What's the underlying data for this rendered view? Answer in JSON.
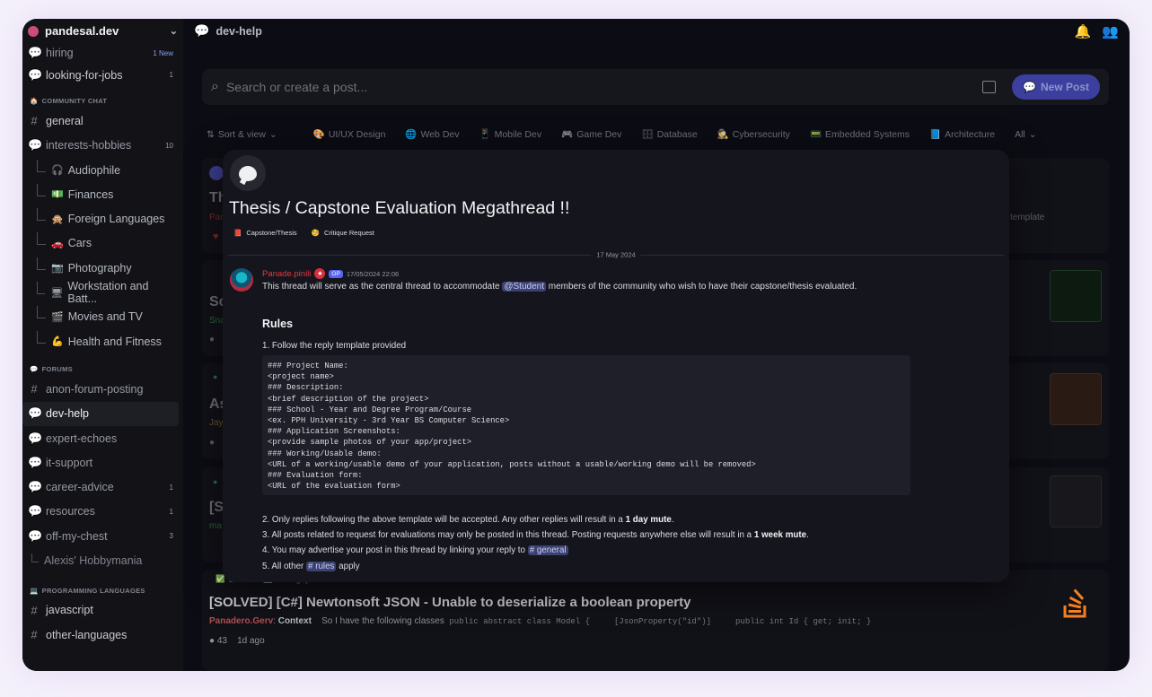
{
  "server": {
    "name": "pandesal.dev"
  },
  "sidebar": {
    "top_channels": [
      {
        "name": "hiring",
        "badge": "1 New"
      },
      {
        "name": "looking-for-jobs",
        "count": "1"
      }
    ],
    "community_chat": {
      "label": "COMMUNITY CHAT",
      "channels": [
        {
          "name": "general"
        },
        {
          "name": "interests-hobbies",
          "count": "10"
        }
      ]
    },
    "hobby_threads": [
      {
        "emoji": "🎧",
        "name": "Audiophile"
      },
      {
        "emoji": "💵",
        "name": "Finances"
      },
      {
        "emoji": "🙊",
        "name": "Foreign Languages"
      },
      {
        "emoji": "🚗",
        "name": "Cars"
      },
      {
        "emoji": "📷",
        "name": "Photography"
      },
      {
        "emoji": "🖥",
        "name": "Workstation and Batt..."
      },
      {
        "emoji": "🎬",
        "name": "Movies and TV"
      },
      {
        "emoji": "💪",
        "name": "Health and Fitness"
      }
    ],
    "forums": {
      "label": "FORUMS",
      "channels": [
        {
          "name": "anon-forum-posting",
          "count": ""
        },
        {
          "name": "dev-help",
          "count": ""
        },
        {
          "name": "expert-echoes",
          "count": ""
        },
        {
          "name": "it-support",
          "count": ""
        },
        {
          "name": "career-advice",
          "count": "1"
        },
        {
          "name": "resources",
          "count": "1"
        },
        {
          "name": "off-my-chest",
          "count": "3"
        }
      ]
    },
    "hobbymania": "Alexis' Hobbymania",
    "programming": {
      "label": "PROGRAMMING LANGUAGES",
      "channels": [
        {
          "name": "javascript"
        },
        {
          "name": "other-languages"
        }
      ]
    }
  },
  "header": {
    "channel": "dev-help"
  },
  "search": {
    "placeholder": "Search or create a post...",
    "new_post": "New Post"
  },
  "filters": {
    "sort": "Sort & view",
    "tags": [
      {
        "emoji": "🎨",
        "label": "UI/UX Design"
      },
      {
        "emoji": "🌐",
        "label": "Web Dev"
      },
      {
        "emoji": "📱",
        "label": "Mobile Dev"
      },
      {
        "emoji": "🎮",
        "label": "Game Dev"
      },
      {
        "emoji": "🗄",
        "label": "Database"
      },
      {
        "emoji": "🕵",
        "label": "Cybersecurity"
      },
      {
        "emoji": "📟",
        "label": "Embedded Systems"
      },
      {
        "emoji": "📘",
        "label": "Architecture"
      }
    ],
    "all": "All"
  },
  "background_posts": {
    "p1_title": "Th",
    "p1_author": "Pan",
    "p1_tail": "template",
    "p2_title": "Sc",
    "p2_author": "Sna",
    "p3_title": "As",
    "p3_author": "Jay",
    "p4_title": "[S",
    "p4_author": "ma"
  },
  "visible_post": {
    "tags": [
      {
        "emoji": "✅",
        "label": "Solved!"
      },
      {
        "emoji": "💻",
        "label": "Coding Questions"
      }
    ],
    "title": "[SOLVED] [C#] Newtonsoft JSON - Unable to deserialize a boolean property",
    "author": "Panadero.Gerv",
    "sep": ": ",
    "context": "Context",
    "preview": "So I have the following classes",
    "code_preview": "public abstract class Model {     [JsonProperty(\"id\")]     public int Id { get; init; }",
    "replies": "43",
    "age": "1d ago"
  },
  "thread": {
    "title": "Thesis / Capstone Evaluation Megathread !!",
    "tags": [
      {
        "emoji": "📕",
        "label": "Capstone/Thesis"
      },
      {
        "emoji": "🧐",
        "label": "Critique Request"
      }
    ],
    "date": "17 May 2024",
    "message": {
      "author": "Panade.pinili",
      "op": "OP",
      "timestamp": "17/05/2024 22:06",
      "intro_1": "This thread will serve as the central thread to accommodate",
      "mention_role": "@Student",
      "intro_2": "members of the community who wish to have their capstone/thesis evaluated.",
      "rules_heading": "Rules",
      "rule1": "1. Follow the reply template provided",
      "code": "### Project Name:\n<project name>\n### Description:\n<brief description of the project>\n### School - Year and Degree Program/Course\n<ex. PPH University - 3rd Year BS Computer Science>\n### Application Screenshots:\n<provide sample photos of your app/project>\n### Working/Usable demo:\n<URL of a working/usable demo of your application, posts without a usable/working demo will be removed>\n### Evaluation form:\n<URL of the evaluation form>",
      "rule2_a": "2. Only replies following the above template will be accepted. Any other replies will result in a",
      "rule2_b": "1 day mute",
      "rule2_c": ".",
      "rule3_a": "3. All posts related to request for evaluations may only be posted in this thread. Posting requests anywhere else will result in a",
      "rule3_b": "1 week mute",
      "rule3_c": ".",
      "rule4_a": "4. You may advertise your post in this thread by linking your reply to",
      "rule4_link": "# general",
      "rule5_a": "5. All other",
      "rule5_link": "# rules",
      "rule5_b": "apply"
    }
  }
}
